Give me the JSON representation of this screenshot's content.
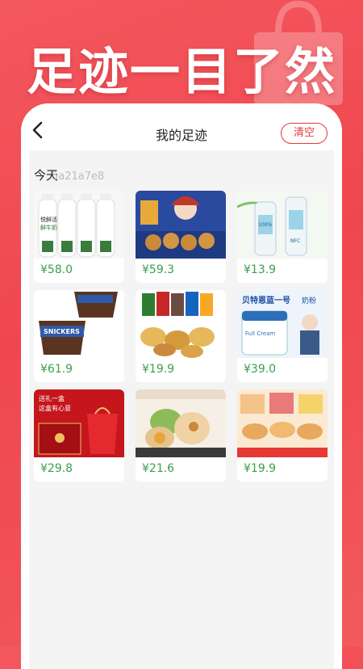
{
  "hero": {
    "headline": "足迹一目了然"
  },
  "nav": {
    "title": "我的足迹",
    "clear_label": "清空",
    "back_icon": "back-arrow-icon"
  },
  "section": {
    "title": "今天",
    "subtitle": "5a21a7e8"
  },
  "products": [
    {
      "name": "fresh-milk-bottles",
      "price": "¥58.0"
    },
    {
      "name": "mooncake-gift-box",
      "price": "¥59.3"
    },
    {
      "name": "coconut-water-bottles",
      "price": "¥13.9"
    },
    {
      "name": "snickers-bucket",
      "price": "¥61.9"
    },
    {
      "name": "snack-assortment",
      "price": "¥19.9"
    },
    {
      "name": "milk-powder",
      "price": "¥39.0"
    },
    {
      "name": "red-gift-box",
      "price": "¥29.8"
    },
    {
      "name": "mochi-buns",
      "price": "¥21.6"
    },
    {
      "name": "bakery-assortment",
      "price": "¥19.9"
    }
  ],
  "thumb_texts": {
    "milk_label": "悦鲜活",
    "milk_sub": "鲜牛奶",
    "snickers": "SNICKERS",
    "milkpowder_banner": "贝特恩蓝一号",
    "milkpowder_tail": "奶粉",
    "milkpowder_can": "Full Cream",
    "giftbox_line1": "送礼一盒",
    "giftbox_line2": "这盒有心意",
    "nfc": "NFC",
    "coconut": "100%"
  },
  "colors": {
    "accent_red": "#e4393c",
    "price_green": "#3aa04a",
    "background_red": "#f0464f"
  }
}
